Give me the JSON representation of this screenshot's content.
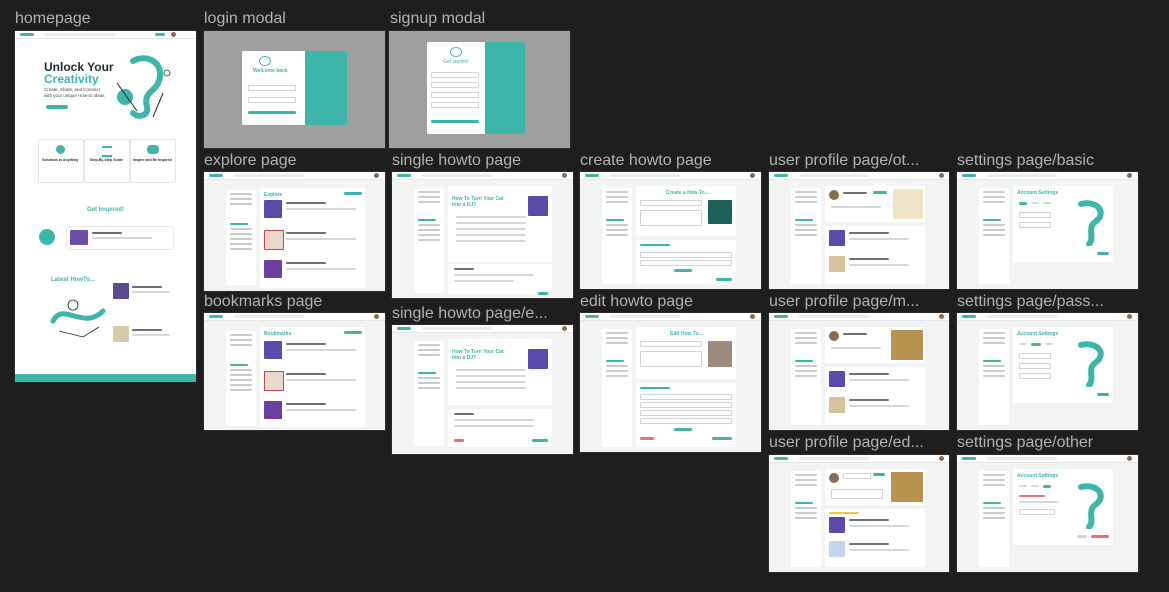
{
  "canvas": {
    "background": "#1e1e1e",
    "label_color": "#b3b3b3",
    "accent": "#3db5a9"
  },
  "frames": {
    "homepage": {
      "label": "homepage"
    },
    "login_modal": {
      "label": "login modal",
      "modal_title": "Welcome back"
    },
    "signup_modal": {
      "label": "signup modal",
      "modal_title": "Get started"
    },
    "explore": {
      "label": "explore page",
      "heading": "Explore"
    },
    "bookmarks": {
      "label": "bookmarks page",
      "heading": "Bookmarks"
    },
    "single_howto": {
      "label": "single howto page",
      "title": "How To Turn Your Cat into a DJ?"
    },
    "single_howto_edit": {
      "label": "single howto page/e...",
      "title": "How To Turn Your Cat into a DJ?"
    },
    "create_howto": {
      "label": "create howto page",
      "heading": "Create a How To..."
    },
    "edit_howto": {
      "label": "edit howto page",
      "heading": "Edit How To..."
    },
    "profile_other": {
      "label": "user profile page/ot..."
    },
    "profile_me": {
      "label": "user profile page/m..."
    },
    "profile_edit": {
      "label": "user profile page/ed..."
    },
    "settings_basic": {
      "label": "settings page/basic",
      "heading": "Account Settings"
    },
    "settings_password": {
      "label": "settings page/pass...",
      "heading": "Account Settings"
    },
    "settings_other": {
      "label": "settings page/other",
      "heading": "Account Settings"
    }
  },
  "homepage": {
    "hero_line1": "Unlock Your",
    "hero_line2": "Creativity",
    "hero_sub": "Create, Share, and Connect with your unique How-to Ideas",
    "features": [
      {
        "title": "Solutions to Anything"
      },
      {
        "title": "Step-By-Step Guide"
      },
      {
        "title": "Inspire and Be Inspired"
      }
    ],
    "get_inspired": "Get Inspired!",
    "latest": "Latest HowTo..."
  }
}
